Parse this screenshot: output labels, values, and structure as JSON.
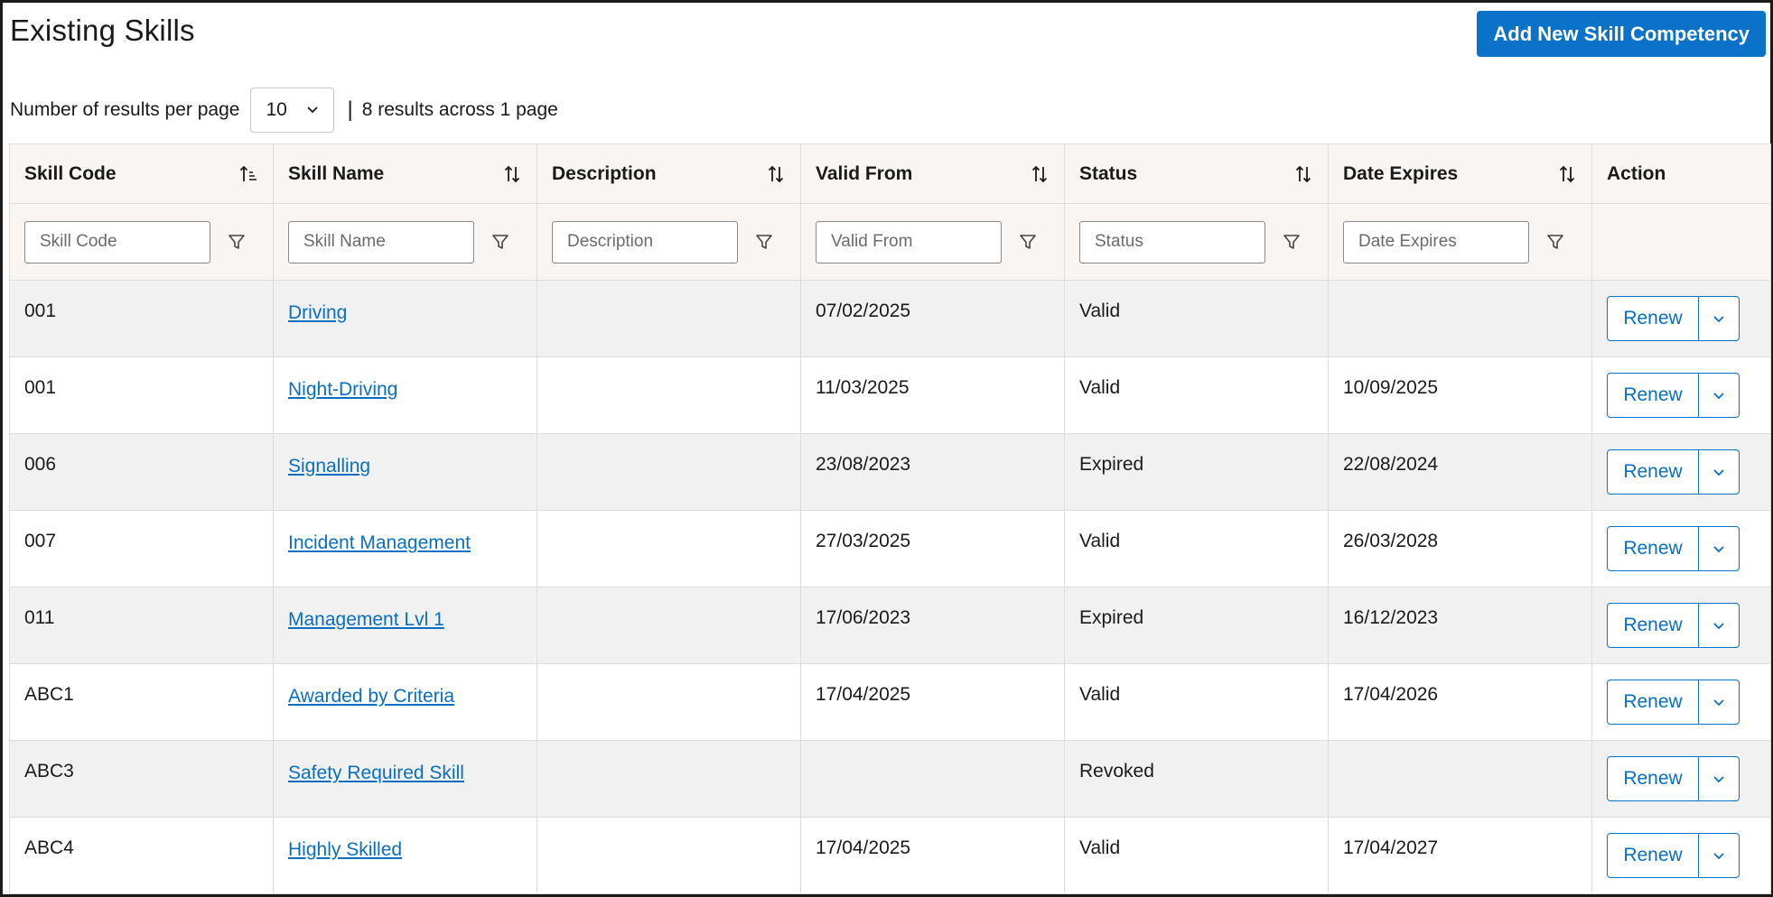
{
  "header": {
    "title": "Existing Skills",
    "add_button_label": "Add New Skill Competency"
  },
  "pagination": {
    "per_page_label": "Number of results per page",
    "per_page_value": "10",
    "separator": "|",
    "results_text": "8 results across 1 page"
  },
  "columns": [
    {
      "label": "Skill Code",
      "filter_placeholder": "Skill Code",
      "sort_icon": "sort-ascending-icon"
    },
    {
      "label": "Skill Name",
      "filter_placeholder": "Skill Name",
      "sort_icon": "sort-icon"
    },
    {
      "label": "Description",
      "filter_placeholder": "Description",
      "sort_icon": "sort-icon"
    },
    {
      "label": "Valid From",
      "filter_placeholder": "Valid From",
      "sort_icon": "sort-icon"
    },
    {
      "label": "Status",
      "filter_placeholder": "Status",
      "sort_icon": "sort-icon"
    },
    {
      "label": "Date Expires",
      "filter_placeholder": "Date Expires",
      "sort_icon": "sort-icon"
    },
    {
      "label": "Action"
    }
  ],
  "rows": [
    {
      "code": "001",
      "name": "Driving",
      "description": "",
      "valid_from": "07/02/2025",
      "status": "Valid",
      "expires": "",
      "action": "Renew"
    },
    {
      "code": "001",
      "name": "Night-Driving",
      "description": "",
      "valid_from": "11/03/2025",
      "status": "Valid",
      "expires": "10/09/2025",
      "action": "Renew"
    },
    {
      "code": "006",
      "name": "Signalling",
      "description": "",
      "valid_from": "23/08/2023",
      "status": "Expired",
      "expires": "22/08/2024",
      "action": "Renew"
    },
    {
      "code": "007",
      "name": "Incident Management",
      "description": "",
      "valid_from": "27/03/2025",
      "status": "Valid",
      "expires": "26/03/2028",
      "action": "Renew"
    },
    {
      "code": "011",
      "name": "Management Lvl 1",
      "description": "",
      "valid_from": "17/06/2023",
      "status": "Expired",
      "expires": "16/12/2023",
      "action": "Renew"
    },
    {
      "code": "ABC1",
      "name": "Awarded by Criteria",
      "description": "",
      "valid_from": "17/04/2025",
      "status": "Valid",
      "expires": "17/04/2026",
      "action": "Renew"
    },
    {
      "code": "ABC3",
      "name": "Safety Required Skill",
      "description": "",
      "valid_from": "",
      "status": "Revoked",
      "expires": "",
      "action": "Renew"
    },
    {
      "code": "ABC4",
      "name": "Highly Skilled",
      "description": "",
      "valid_from": "17/04/2025",
      "status": "Valid",
      "expires": "17/04/2027",
      "action": "Renew"
    }
  ],
  "colors": {
    "accent": "#0a72c9",
    "link": "#0a6fc2",
    "header_bg": "#f8f5f2",
    "row_alt_bg": "#f1f1f1"
  }
}
